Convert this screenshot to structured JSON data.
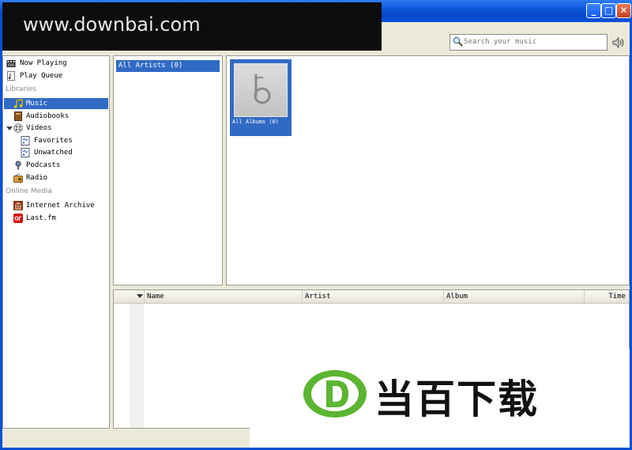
{
  "window": {
    "controls": {
      "minimize": "_",
      "maximize": "□",
      "close": "✕"
    }
  },
  "watermark": {
    "banner_text": "www.downbai.com",
    "logo_text": "当百下载",
    "logo_letter": "D"
  },
  "search": {
    "placeholder": "Search your music"
  },
  "sidebar": {
    "top_items": [
      {
        "label": "Now Playing",
        "icon": "now-playing-icon"
      },
      {
        "label": "Play Queue",
        "icon": "play-queue-icon"
      }
    ],
    "libraries_heading": "Libraries",
    "libraries": [
      {
        "label": "Music",
        "icon": "music-note-icon",
        "selected": true
      },
      {
        "label": "Audiobooks",
        "icon": "audiobook-icon"
      },
      {
        "label": "Videos",
        "icon": "video-icon",
        "expanded": true
      },
      {
        "label": "Favorites",
        "icon": "smart-playlist-icon"
      },
      {
        "label": "Unwatched",
        "icon": "smart-playlist-icon"
      },
      {
        "label": "Podcasts",
        "icon": "podcast-icon"
      },
      {
        "label": "Radio",
        "icon": "radio-icon"
      }
    ],
    "online_heading": "Online Media",
    "online": [
      {
        "label": "Internet Archive",
        "icon": "archive-icon"
      },
      {
        "label": "Last.fm",
        "icon": "lastfm-icon"
      }
    ]
  },
  "artists": {
    "all_label": "All Artists (0)"
  },
  "albums": {
    "all_label": "All Albums (0)"
  },
  "tracks": {
    "columns": [
      "Name",
      "Artist",
      "Album",
      "Time"
    ]
  },
  "colors": {
    "selection": "#316ac5",
    "titlebar": "#0a52d8",
    "logo_green": "#5cb531"
  }
}
